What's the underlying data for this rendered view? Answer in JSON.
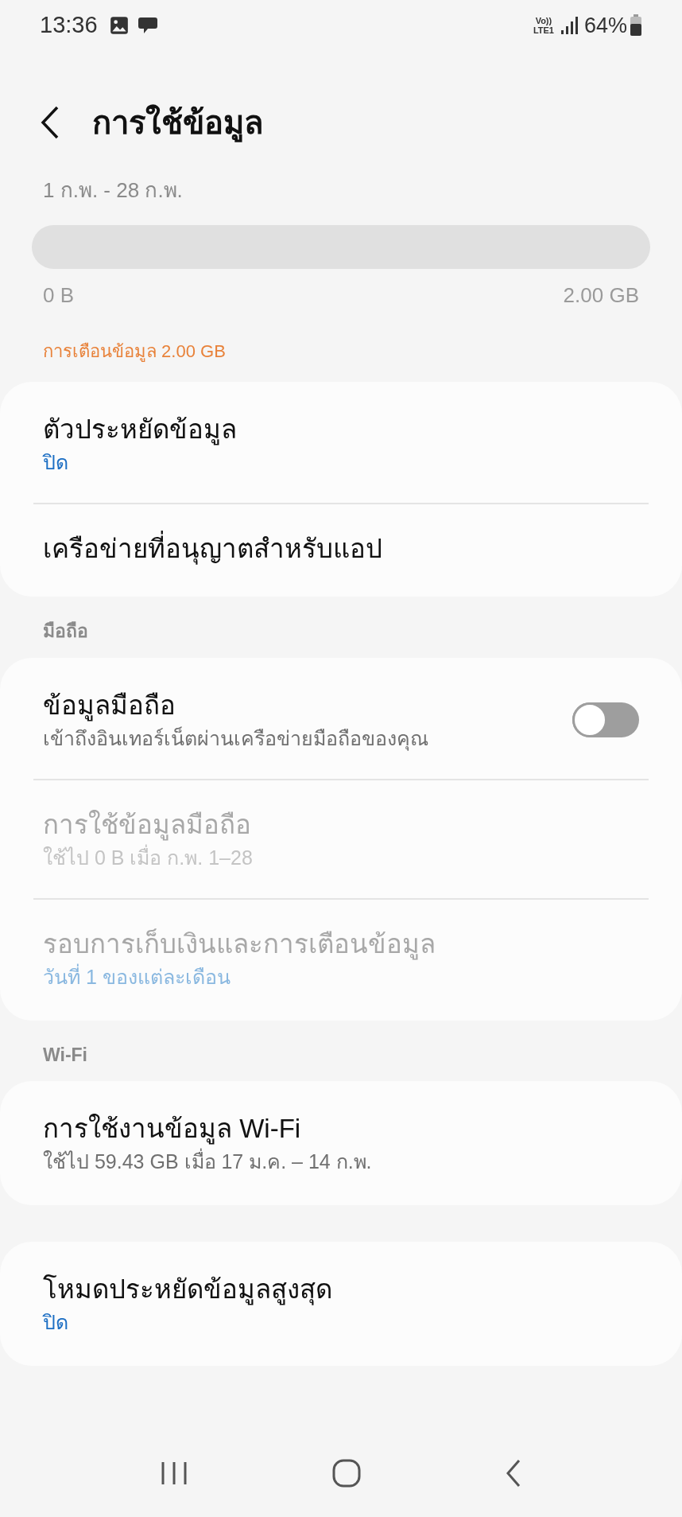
{
  "status_bar": {
    "time": "13:36",
    "network": [
      "Vo))",
      "LTE1"
    ],
    "battery": "64%"
  },
  "header": {
    "title": "การใช้ข้อมูล"
  },
  "usage": {
    "period": "1 ก.พ. - 28 ก.พ.",
    "min_label": "0 B",
    "max_label": "2.00 GB",
    "warning": "การเตือนข้อมูล 2.00 GB"
  },
  "sections": [
    {
      "items": [
        {
          "kind": "nav",
          "title": "ตัวประหยัดข้อมูล",
          "subtitle": {
            "text": "ปิด",
            "kind": "value"
          },
          "disabled": false
        },
        {
          "kind": "nav",
          "title": "เครือข่ายที่อนุญาตสำหรับแอป",
          "disabled": false
        }
      ]
    },
    {
      "header": "มือถือ",
      "items": [
        {
          "kind": "toggle",
          "title": "ข้อมูลมือถือ",
          "subtitle": {
            "text": "เข้าถึงอินเทอร์เน็ตผ่านเครือข่ายมือถือของคุณ",
            "kind": "description"
          },
          "disabled": false,
          "on": false
        },
        {
          "kind": "nav",
          "title": "การใช้ข้อมูลมือถือ",
          "subtitle": {
            "text": "ใช้ไป 0 B เมื่อ ก.พ. 1–28",
            "kind": "description"
          },
          "disabled": true
        },
        {
          "kind": "nav",
          "title": "รอบการเก็บเงินและการเตือนข้อมูล",
          "subtitle": {
            "text": "วันที่ 1 ของแต่ละเดือน",
            "kind": "value"
          },
          "disabled": true
        }
      ]
    },
    {
      "header": "Wi-Fi",
      "items": [
        {
          "kind": "nav",
          "title": "การใช้งานข้อมูล Wi-Fi",
          "subtitle": {
            "text": "ใช้ไป 59.43 GB เมื่อ 17 ม.ค. – 14 ก.พ.",
            "kind": "description"
          },
          "disabled": false
        }
      ]
    },
    {
      "items": [
        {
          "kind": "nav",
          "title": "โหมดประหยัดข้อมูลสูงสุด",
          "subtitle": {
            "text": "ปิด",
            "kind": "value"
          },
          "disabled": false
        }
      ]
    }
  ]
}
